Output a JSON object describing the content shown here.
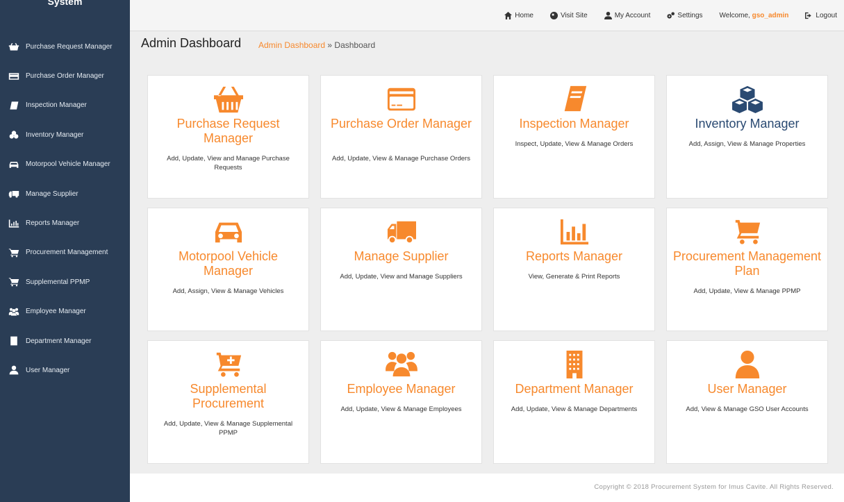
{
  "sidebar": {
    "brand": "System",
    "items": [
      {
        "label": "Purchase Request Manager",
        "icon": "basket-icon"
      },
      {
        "label": "Purchase Order Manager",
        "icon": "credit-card-icon"
      },
      {
        "label": "Inspection Manager",
        "icon": "book-icon"
      },
      {
        "label": "Inventory Manager",
        "icon": "cubes-icon"
      },
      {
        "label": "Motorpool Vehicle Manager",
        "icon": "car-icon"
      },
      {
        "label": "Manage Supplier",
        "icon": "truck-icon"
      },
      {
        "label": "Reports Manager",
        "icon": "bar-chart-icon"
      },
      {
        "label": "Procurement Management",
        "icon": "cart-icon"
      },
      {
        "label": "Supplemental PPMP",
        "icon": "cart-plus-icon"
      },
      {
        "label": "Employee Manager",
        "icon": "users-icon"
      },
      {
        "label": "Department Manager",
        "icon": "building-icon"
      },
      {
        "label": "User Manager",
        "icon": "user-icon"
      }
    ]
  },
  "topnav": {
    "home": "Home",
    "visit_site": "Visit Site",
    "my_account": "My Account",
    "settings": "Settings",
    "welcome_prefix": "Welcome,",
    "username": "gso_admin",
    "logout": "Logout"
  },
  "header": {
    "title": "Admin Dashboard",
    "breadcrumb_link": "Admin Dashboard",
    "breadcrumb_sep": " » ",
    "breadcrumb_current": "Dashboard"
  },
  "cards": [
    {
      "title": "Purchase Request Manager",
      "desc": "Add, Update, View and Manage Purchase Requests",
      "icon": "basket-icon"
    },
    {
      "title": "Purchase Order Manager",
      "desc": "Add, Update, View & Manage Purchase Orders",
      "icon": "credit-card-icon"
    },
    {
      "title": "Inspection Manager",
      "desc": "Inspect, Update, View & Manage Orders",
      "icon": "book-icon"
    },
    {
      "title": "Inventory Manager",
      "desc": "Add, Assign, View & Manage Properties",
      "icon": "cubes-icon"
    },
    {
      "title": "Motorpool Vehicle Manager",
      "desc": "Add, Assign, View & Manage Vehicles",
      "icon": "car-icon"
    },
    {
      "title": "Manage Supplier",
      "desc": "Add, Update, View and Manage Suppliers",
      "icon": "truck-icon"
    },
    {
      "title": "Reports Manager",
      "desc": "View, Generate & Print Reports",
      "icon": "bar-chart-icon"
    },
    {
      "title": "Procurement Management Plan",
      "desc": "Add, Update, View & Manage PPMP",
      "icon": "cart-icon"
    },
    {
      "title": "Supplemental Procurement",
      "desc": "Add, Update, View & Manage Supplemental PPMP",
      "icon": "cart-plus-icon"
    },
    {
      "title": "Employee Manager",
      "desc": "Add, Update, View & Manage Employees",
      "icon": "users-icon"
    },
    {
      "title": "Department Manager",
      "desc": "Add, Update, View & Manage Departments",
      "icon": "building-icon"
    },
    {
      "title": "User Manager",
      "desc": "Add, View & Manage GSO User Accounts",
      "icon": "user-icon"
    }
  ],
  "footer": {
    "copyright": "Copyright © 2018 Procurement System for Imus Cavite. All Rights Reserved."
  },
  "colors": {
    "sidebar_bg": "#2a3d55",
    "accent": "#f7892d",
    "inventory_accent": "#2a4a72",
    "page_bg": "#eeeeee"
  }
}
